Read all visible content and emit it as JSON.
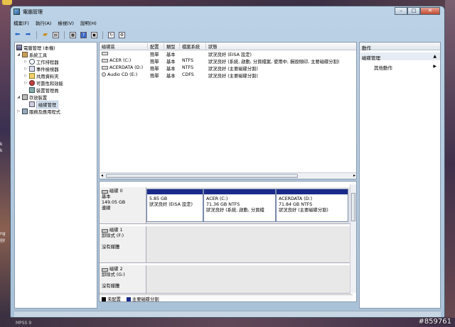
{
  "window": {
    "title": "電腦管理"
  },
  "menu": [
    "檔案(F)",
    "執行(A)",
    "檢視(V)",
    "說明(H)"
  ],
  "toolbar_icons": [
    "back-arrow-icon",
    "forward-arrow-icon",
    "up-folder-icon",
    "show-hide-tree-icon",
    "properties-icon",
    "help-icon",
    "export-icon",
    "refresh-icon"
  ],
  "tree": {
    "root": "電腦管理 (本機)",
    "system_tools": "系統工具",
    "task_scheduler": "工作排程器",
    "event_viewer": "事件檢視器",
    "shared_folders": "共用資料夾",
    "reliability": "可靠性和效能",
    "device_manager": "裝置管理員",
    "storage": "存放裝置",
    "disk_management": "磁碟管理",
    "services": "服務及應用程式"
  },
  "volume_table": {
    "headers": [
      "磁碟區",
      "配置",
      "類型",
      "檔案系統",
      "狀態"
    ],
    "rows": [
      {
        "name": "",
        "layout": "簡單",
        "type": "基本",
        "fs": "",
        "status": "狀況良好 (EISA 設定)"
      },
      {
        "name": "ACER (C:)",
        "layout": "簡單",
        "type": "基本",
        "fs": "NTFS",
        "status": "狀況良好 (系統, 啟動, 分頁檔案, 使用中, 損毀傾印, 主要磁碟分割)"
      },
      {
        "name": "ACERDATA (D:)",
        "layout": "簡單",
        "type": "基本",
        "fs": "NTFS",
        "status": "狀況良好 (主要磁碟分割)"
      },
      {
        "name": "Audio CD (E:)",
        "layout": "簡單",
        "type": "基本",
        "fs": "CDFS",
        "status": "狀況良好 (主要磁碟分割)"
      }
    ]
  },
  "disks": [
    {
      "name": "磁碟 0",
      "kind": "基本",
      "size": "149.05 GB",
      "state": "連線",
      "partitions": [
        {
          "title": "",
          "size": "5.85 GB",
          "status": "狀況良好 (EISA 設定)"
        },
        {
          "title": "ACER (C:)",
          "size": "71.36 GB NTFS",
          "status": "狀況良好 (系統, 啟動, 分頁檔"
        },
        {
          "title": "ACERDATA (D:)",
          "size": "71.84 GB NTFS",
          "status": "狀況良好 (主要磁碟分割)"
        }
      ]
    },
    {
      "name": "磁碟 1",
      "kind": "卸除式 (F:)",
      "size": "",
      "state": "沒有媒體",
      "partitions": []
    },
    {
      "name": "磁碟 2",
      "kind": "卸除式 (G:)",
      "size": "",
      "state": "沒有媒體",
      "partitions": []
    }
  ],
  "legend": [
    {
      "label": "未配置",
      "color": "#000000"
    },
    {
      "label": "主要磁碟分割",
      "color": "#1a2a8a"
    }
  ],
  "actions": {
    "header": "動作",
    "section": "磁碟管理",
    "item": "其他動作"
  },
  "side_texts": [
    "k",
    "k",
    "ng",
    "gy"
  ],
  "bottom_left": "MPSS 9",
  "watermark": "#859761"
}
